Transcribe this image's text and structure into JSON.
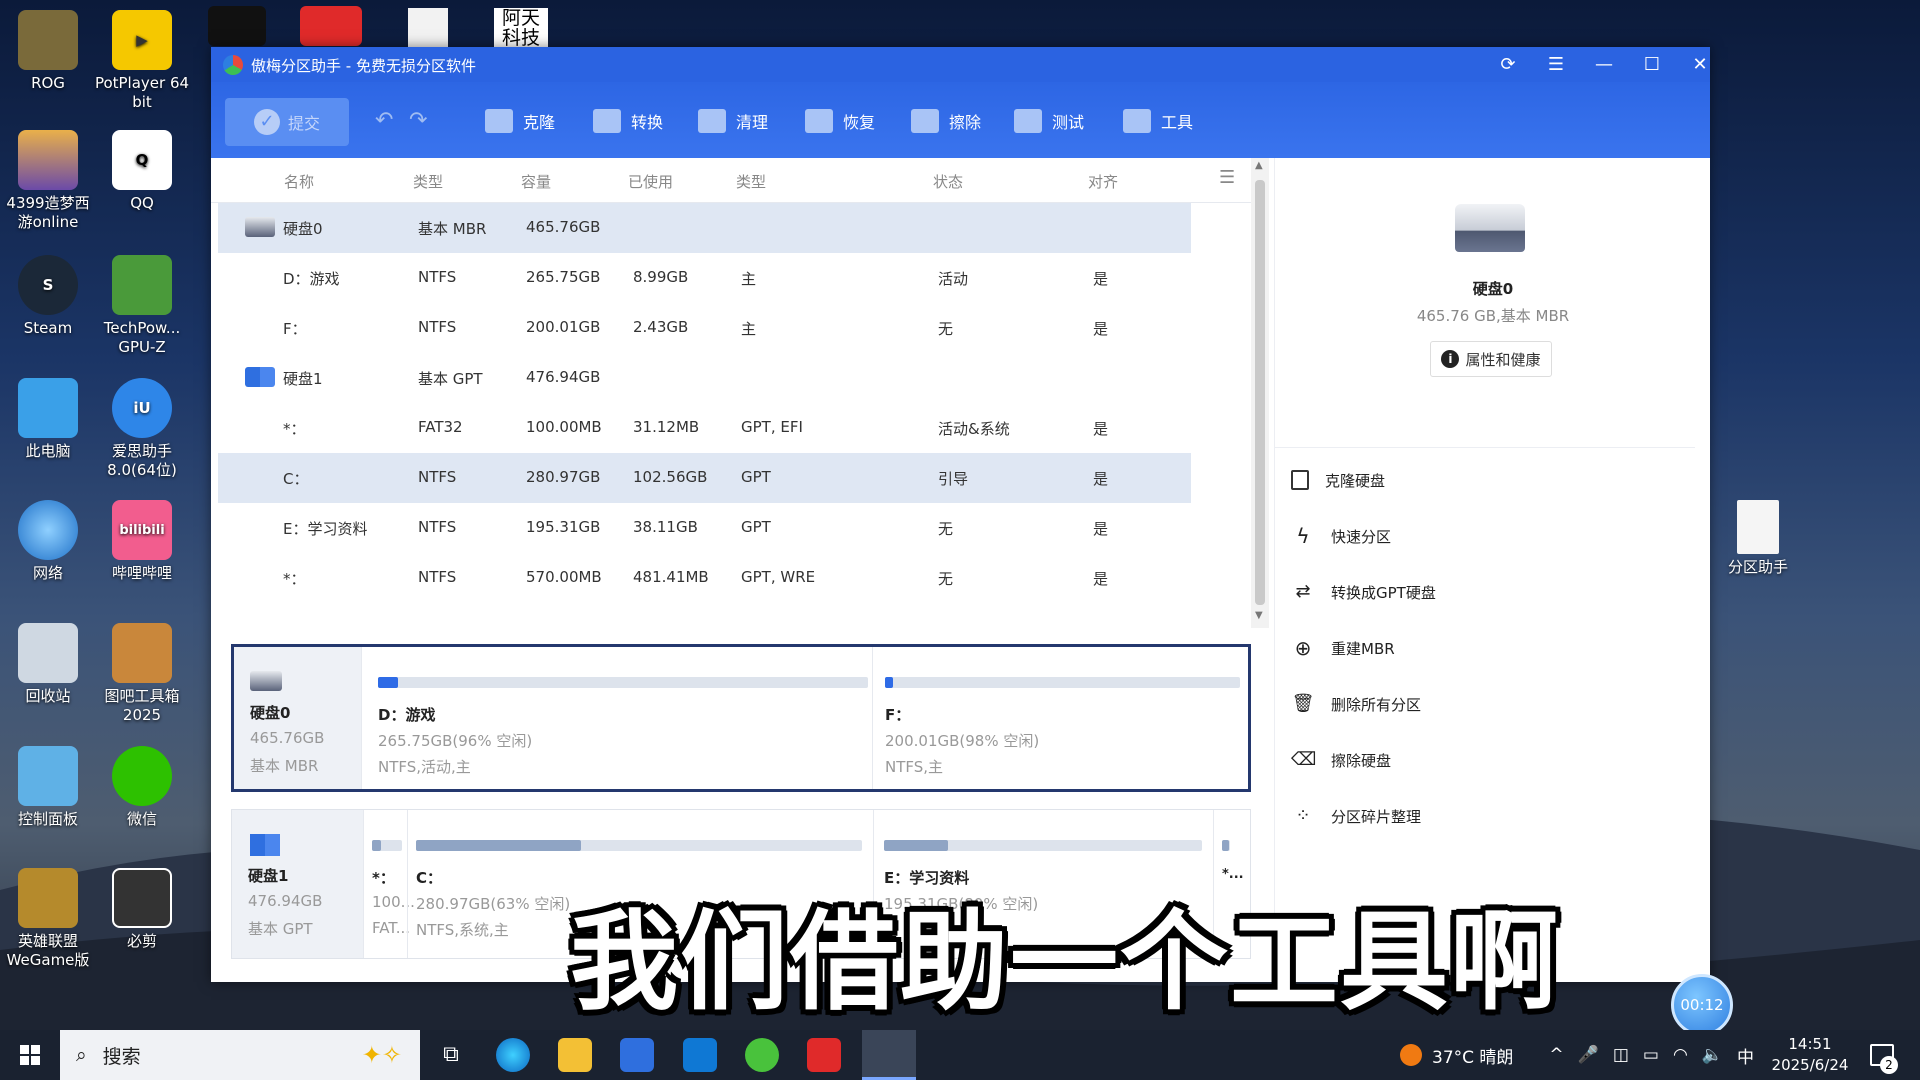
{
  "desktop": {
    "icons_left": [
      {
        "label": "ROG",
        "name": "rog-icon"
      },
      {
        "label": "4399造梦西\n游online",
        "name": "game-4399-icon"
      },
      {
        "label": "Steam",
        "name": "steam-icon"
      },
      {
        "label": "此电脑",
        "name": "this-pc-icon"
      },
      {
        "label": "网络",
        "name": "network-icon"
      },
      {
        "label": "回收站",
        "name": "recycle-bin-icon"
      },
      {
        "label": "控制面板",
        "name": "control-panel-icon"
      },
      {
        "label": "英雄联盟\nWeGame版",
        "name": "lol-wegame-icon"
      }
    ],
    "icons_col2": [
      {
        "label": "PotPlayer 64\nbit",
        "name": "potplayer-icon"
      },
      {
        "label": "QQ",
        "name": "qq-icon"
      },
      {
        "label": "TechPow...\nGPU-Z",
        "name": "gpuz-icon"
      },
      {
        "label": "爱思助手\n8.0(64位)",
        "name": "i4-icon"
      },
      {
        "label": "哔哩哔哩",
        "name": "bilibili-icon"
      },
      {
        "label": "图吧工具箱\n2025",
        "name": "tuba-toolbox-icon"
      },
      {
        "label": "微信",
        "name": "wechat-icon"
      },
      {
        "label": "必剪",
        "name": "bijian-icon"
      }
    ],
    "right_icon": {
      "label": "分区助手"
    },
    "top_partial": {
      "label": "阿天\n科技"
    }
  },
  "window": {
    "title": "傲梅分区助手 - 免费无损分区软件"
  },
  "toolbar": {
    "submit": "提交",
    "tools": [
      "克隆",
      "转换",
      "清理",
      "恢复",
      "擦除",
      "测试",
      "工具"
    ]
  },
  "list": {
    "headers": [
      "名称",
      "类型",
      "容量",
      "已使用",
      "类型",
      "状态",
      "对齐"
    ],
    "rows": [
      {
        "name": "硬盘0",
        "type": "基本 MBR",
        "cap": "465.76GB",
        "used": "",
        "ptype": "",
        "status": "",
        "align": "",
        "disk": true,
        "sel": true
      },
      {
        "name": "D：游戏",
        "type": "NTFS",
        "cap": "265.75GB",
        "used": "8.99GB",
        "ptype": "主",
        "status": "活动",
        "align": "是"
      },
      {
        "name": "F：",
        "type": "NTFS",
        "cap": "200.01GB",
        "used": "2.43GB",
        "ptype": "主",
        "status": "无",
        "align": "是"
      },
      {
        "name": "硬盘1",
        "type": "基本 GPT",
        "cap": "476.94GB",
        "used": "",
        "ptype": "",
        "status": "",
        "align": "",
        "disk": true
      },
      {
        "name": "*：",
        "type": "FAT32",
        "cap": "100.00MB",
        "used": "31.12MB",
        "ptype": "GPT, EFI",
        "status": "活动&系统",
        "align": "是"
      },
      {
        "name": "C：",
        "type": "NTFS",
        "cap": "280.97GB",
        "used": "102.56GB",
        "ptype": "GPT",
        "status": "引导",
        "align": "是",
        "sel": true
      },
      {
        "name": "E：学习资料",
        "type": "NTFS",
        "cap": "195.31GB",
        "used": "38.11GB",
        "ptype": "GPT",
        "status": "无",
        "align": "是"
      },
      {
        "name": "*：",
        "type": "NTFS",
        "cap": "570.00MB",
        "used": "481.41MB",
        "ptype": "GPT, WRE",
        "status": "无",
        "align": "是"
      }
    ]
  },
  "map": {
    "disk0": {
      "name": "硬盘0",
      "size": "465.76GB",
      "type": "基本 MBR",
      "parts": [
        {
          "name": "D：游戏",
          "size": "265.75GB(96% 空闲)",
          "info": "NTFS,活动,主",
          "used_fraction": 0.04
        },
        {
          "name": "F：",
          "size": "200.01GB(98% 空闲)",
          "info": "NTFS,主",
          "used_fraction": 0.02
        }
      ]
    },
    "disk1": {
      "name": "硬盘1",
      "size": "476.94GB",
      "type": "基本 GPT",
      "parts": [
        {
          "name": "*：",
          "size": "100...",
          "info": "FAT...",
          "used_fraction": 0.31
        },
        {
          "name": "C：",
          "size": "280.97GB(63% 空闲)",
          "info": "NTFS,系统,主",
          "used_fraction": 0.37
        },
        {
          "name": "E：学习资料",
          "size": "195.31GB(80% 空闲)",
          "info": "",
          "used_fraction": 0.2
        },
        {
          "name": "*...",
          "size": "",
          "info": "",
          "used_fraction": 0.84
        }
      ]
    }
  },
  "side": {
    "disk_name": "硬盘0",
    "disk_desc": "465.76 GB,基本 MBR",
    "prop_btn": "属性和健康",
    "ops": [
      "克隆硬盘",
      "快速分区",
      "转换成GPT硬盘",
      "重建MBR",
      "删除所有分区",
      "擦除硬盘",
      "分区碎片整理"
    ]
  },
  "caption": "我们借助一个工具啊",
  "timer": "00:12",
  "taskbar": {
    "search": "搜索",
    "weather": "37°C 晴朗",
    "ime": "中",
    "time": "14:51",
    "date": "2025/6/24",
    "notif": "2"
  }
}
